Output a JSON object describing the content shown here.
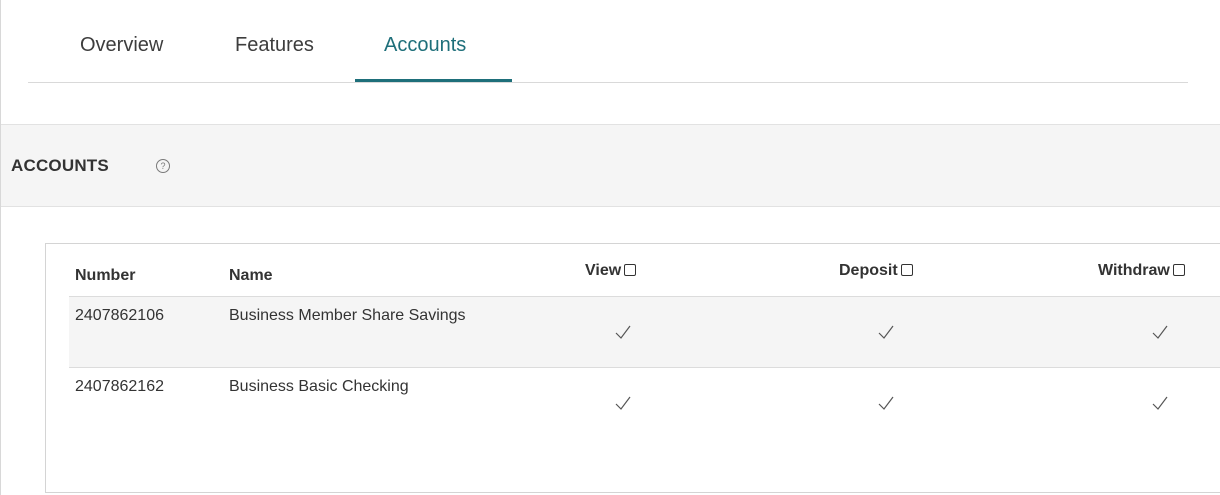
{
  "tabs": [
    {
      "label": "Overview",
      "active": false
    },
    {
      "label": "Features",
      "active": false
    },
    {
      "label": "Accounts",
      "active": true
    }
  ],
  "section": {
    "title": "ACCOUNTS",
    "help_icon": "question-circle-icon"
  },
  "table": {
    "columns": {
      "number": "Number",
      "name": "Name",
      "view": "View",
      "deposit": "Deposit",
      "withdraw": "Withdraw"
    },
    "header_checkboxes": {
      "view": false,
      "deposit": false,
      "withdraw": false
    },
    "rows": [
      {
        "number": "2407862106",
        "name": "Business Member Share Savings",
        "view": true,
        "deposit": true,
        "withdraw": true
      },
      {
        "number": "2407862162",
        "name": "Business Basic Checking",
        "view": true,
        "deposit": true,
        "withdraw": true
      }
    ]
  },
  "colors": {
    "accent": "#1e6f7a",
    "header_bg": "#f5f5f5",
    "text": "#333333"
  }
}
